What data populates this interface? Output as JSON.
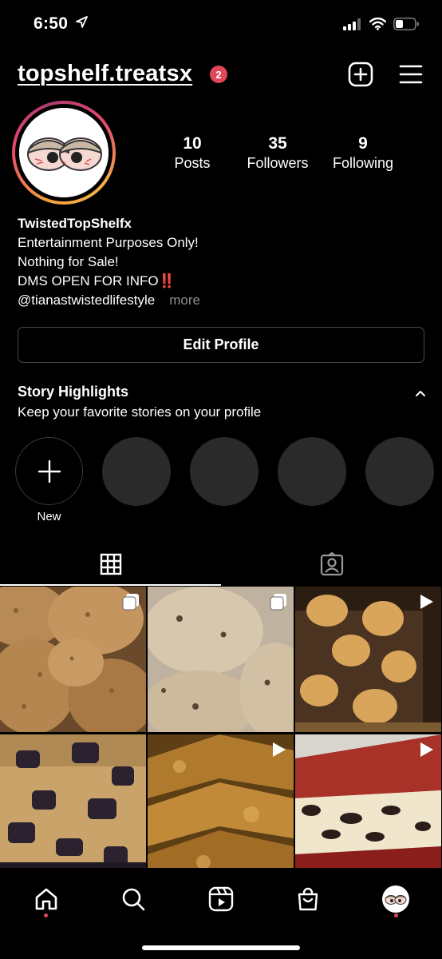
{
  "status_bar": {
    "time": "6:50"
  },
  "header": {
    "username": "topshelf.treatsx",
    "notification_count": "2"
  },
  "profile": {
    "stats": [
      {
        "value": "10",
        "label": "Posts"
      },
      {
        "value": "35",
        "label": "Followers"
      },
      {
        "value": "9",
        "label": "Following"
      }
    ],
    "bio": {
      "name": "TwistedTopShelfx",
      "lines": [
        "Entertainment Purposes Only!",
        "Nothing for Sale!",
        "DMS OPEN FOR INFO‼️"
      ],
      "handle": "@tianastwistedlifestyle",
      "more": "more"
    },
    "edit_button": "Edit Profile"
  },
  "highlights": {
    "title": "Story Highlights",
    "subtitle": "Keep your favorite stories on your profile",
    "new_label": "New"
  },
  "tabs": [
    "grid-tab",
    "tagged-tab"
  ],
  "grid": [
    {
      "type": "carousel",
      "desc": "oatmeal cookies"
    },
    {
      "type": "carousel",
      "desc": "chocolate chip cookies"
    },
    {
      "type": "video",
      "desc": "s'mores brownies"
    },
    {
      "type": "image",
      "desc": "oreo cookie bars"
    },
    {
      "type": "video",
      "desc": "blondies"
    },
    {
      "type": "video",
      "desc": "red velvet cheesecake"
    }
  ],
  "bottom_nav": [
    "home-icon",
    "search-icon",
    "reels-icon",
    "shop-icon",
    "profile-avatar"
  ],
  "colors": {
    "background": "#000000",
    "badge": "#e0475a",
    "muted": "#8e8e8e"
  }
}
